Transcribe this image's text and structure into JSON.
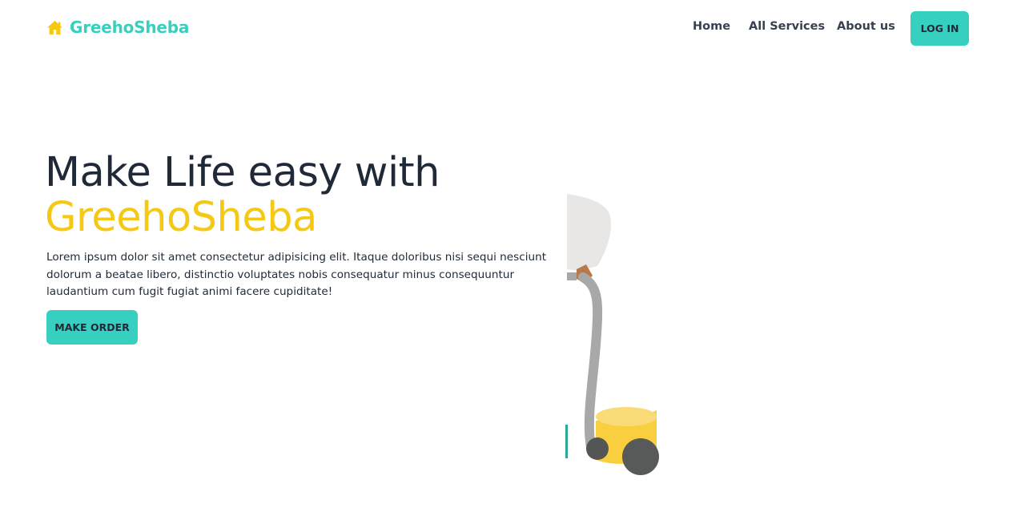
{
  "brand": {
    "name": "GreehoSheba",
    "icon": "home-icon",
    "color": "#36cfc0",
    "icon_color": "#f5c813"
  },
  "nav": {
    "items": [
      {
        "label": "Home"
      },
      {
        "label": "All Services"
      },
      {
        "label": "About us"
      }
    ],
    "login_label": "LOG IN"
  },
  "hero": {
    "title_line1": "Make Life easy with",
    "title_line2": "GreehoSheba",
    "description": "Lorem ipsum dolor sit amet consectetur adipisicing elit. Itaque doloribus nisi sequi nesciunt dolorum a beatae libero, distinctio voluptates nobis consequatur minus consequuntur laudantium cum fugit fugiat animi facere cupiditate!",
    "cta_label": "MAKE ORDER",
    "illustration": "vacuum-cleaner-illustration"
  },
  "colors": {
    "accent": "#36cfc0",
    "highlight": "#f5c813",
    "text": "#1f2937"
  }
}
